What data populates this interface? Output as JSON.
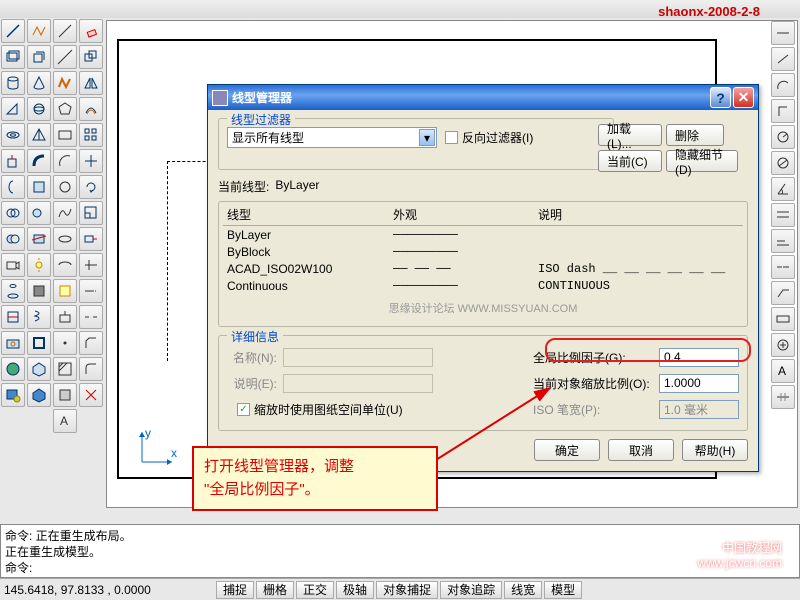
{
  "watermark": "shaonx-2008-2-8",
  "dialog": {
    "title": "线型管理器",
    "filter_group": "线型过滤器",
    "filter_combo": "显示所有线型",
    "reverse_filter": "反向过滤器(I)",
    "btn_load": "加载(L)...",
    "btn_delete": "删除",
    "btn_current": "当前(C)",
    "btn_hide": "隐藏细节(D)",
    "current_label": "当前线型:",
    "current_value": "ByLayer",
    "col_linetype": "线型",
    "col_appearance": "外观",
    "col_desc": "说明",
    "rows": [
      {
        "name": "ByLayer",
        "sample": "─────────",
        "desc": ""
      },
      {
        "name": "ByBlock",
        "sample": "─────────",
        "desc": ""
      },
      {
        "name": "ACAD_ISO02W100",
        "sample": "── ── ──",
        "desc": "ISO dash __ __ __ __ __ __"
      },
      {
        "name": "Continuous",
        "sample": "─────────",
        "desc": "CONTINUOUS"
      }
    ],
    "forum_watermark": "思缘设计论坛  WWW.MISSYUAN.COM",
    "details_group": "详细信息",
    "name_label": "名称(N):",
    "desc_label": "说明(E):",
    "global_label": "全局比例因子(G):",
    "global_value": "0.4",
    "obj_label": "当前对象缩放比例(O):",
    "obj_value": "1.0000",
    "iso_label": "ISO 笔宽(P):",
    "iso_value": "1.0 毫米",
    "scale_checkbox": "缩放时使用图纸空间单位(U)",
    "btn_ok": "确定",
    "btn_cancel": "取消",
    "btn_help": "帮助(H)"
  },
  "annotation": "打开线型管理器，调整\n\"全局比例因子\"。",
  "cmdlines": {
    "l1": "命令:  正在重生成布局。",
    "l2": "正在重生成模型。",
    "l3": "命令:"
  },
  "status": {
    "coord": "145.6418, 97.8133 , 0.0000",
    "b1": "捕捉",
    "b2": "栅格",
    "b3": "正交",
    "b4": "极轴",
    "b5": "对象捕捉",
    "b6": "对象追踪",
    "b7": "线宽",
    "b8": "模型"
  },
  "bottom_water": {
    "l1": "中国教程网",
    "l2": "www.jcwcn.com"
  }
}
